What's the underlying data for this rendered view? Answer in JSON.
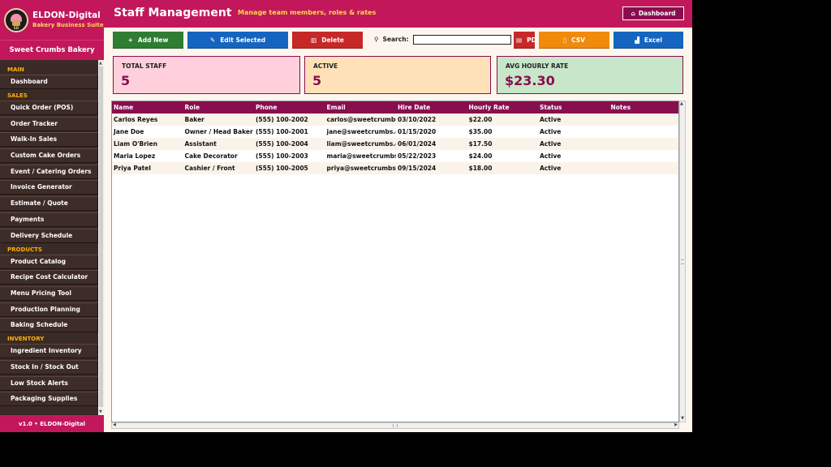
{
  "app": {
    "name": "ELDON-Digital",
    "subtitle": "Bakery Business Suite",
    "logo_text": "ED",
    "business_name": "Sweet Crumbs Bakery",
    "footer": "v1.0  •  ELDON-Digital"
  },
  "sidebar": {
    "sections": [
      {
        "title": "MAIN",
        "items": [
          "Dashboard"
        ]
      },
      {
        "title": "SALES",
        "items": [
          "Quick Order (POS)",
          "Order Tracker",
          "Walk-In Sales",
          "Custom Cake Orders",
          "Event / Catering Orders",
          "Invoice Generator",
          "Estimate / Quote",
          "Payments",
          "Delivery Schedule"
        ]
      },
      {
        "title": "PRODUCTS",
        "items": [
          "Product Catalog",
          "Recipe Cost Calculator",
          "Menu Pricing Tool",
          "Production Planning",
          "Baking Schedule"
        ]
      },
      {
        "title": "INVENTORY",
        "items": [
          "Ingredient Inventory",
          "Stock In / Stock Out",
          "Low Stock Alerts",
          "Packaging Supplies"
        ]
      }
    ]
  },
  "header": {
    "title": "Staff Management",
    "subtitle": "Manage team members, roles & rates",
    "dashboard_label": "Dashboard"
  },
  "toolbar": {
    "add_label": "Add New",
    "edit_label": "Edit Selected",
    "delete_label": "Delete",
    "search_label": "Search:",
    "search_value": "",
    "pdf_label": "PDF",
    "csv_label": "CSV",
    "excel_label": "Excel"
  },
  "stats": {
    "total_label": "TOTAL STAFF",
    "total_value": "5",
    "active_label": "ACTIVE",
    "active_value": "5",
    "rate_label": "AVG HOURLY RATE",
    "rate_value": "$23.30"
  },
  "table": {
    "columns": [
      "Name",
      "Role",
      "Phone",
      "Email",
      "Hire Date",
      "Hourly Rate",
      "Status",
      "Notes"
    ],
    "rows": [
      [
        "Carlos Reyes",
        "Baker",
        "(555) 100-2002",
        "carlos@sweetcrumbs.com",
        "03/10/2022",
        "$22.00",
        "Active",
        ""
      ],
      [
        "Jane Doe",
        "Owner / Head Baker",
        "(555) 100-2001",
        "jane@sweetcrumbs.com",
        "01/15/2020",
        "$35.00",
        "Active",
        ""
      ],
      [
        "Liam O'Brien",
        "Assistant",
        "(555) 100-2004",
        "liam@sweetcrumbs.com",
        "06/01/2024",
        "$17.50",
        "Active",
        ""
      ],
      [
        "Maria Lopez",
        "Cake Decorator",
        "(555) 100-2003",
        "maria@sweetcrumbs.com",
        "05/22/2023",
        "$24.00",
        "Active",
        ""
      ],
      [
        "Priya Patel",
        "Cashier / Front",
        "(555) 100-2005",
        "priya@sweetcrumbs.com",
        "09/15/2024",
        "$18.00",
        "Active",
        ""
      ]
    ]
  },
  "colors": {
    "brand": "#c2185b",
    "brand_dark": "#880e4f",
    "sidebar_bg": "#3a2a26",
    "accent_yellow": "#ffd54f",
    "add": "#2e7d32",
    "edit": "#1565c0",
    "delete": "#c62828",
    "csv": "#ef8a0c"
  },
  "icons": {
    "add": "plus-icon",
    "edit": "pencil-icon",
    "delete": "trash-icon",
    "search": "magnifier-icon",
    "pdf": "document-icon",
    "csv": "file-icon",
    "excel": "chart-icon",
    "dashboard": "home-icon"
  }
}
